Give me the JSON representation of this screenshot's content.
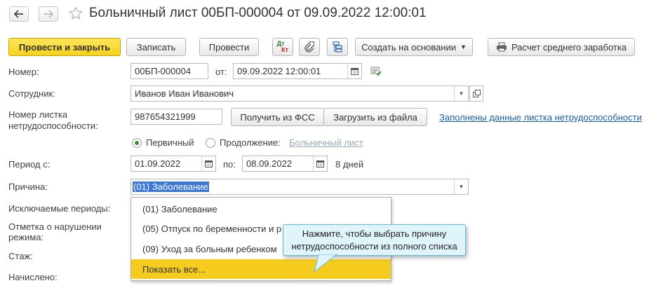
{
  "window": {
    "title": "Больничный лист 00БП-000004 от 09.09.2022 12:00:01"
  },
  "toolbar": {
    "post_close": "Провести и закрыть",
    "save": "Записать",
    "post": "Провести",
    "dtkt_top": "Дт",
    "dtkt_bottom": "Кт",
    "create_based": "Создать на основании",
    "calc_avg": "Расчет среднего заработка"
  },
  "form": {
    "number_label": "Номер:",
    "number_value": "00БП-000004",
    "from_label": "от:",
    "date_value": "09.09.2022 12:00:01",
    "employee_label": "Сотрудник:",
    "employee_value": "Иванов Иван Иванович",
    "sheet_number_label_1": "Номер листка",
    "sheet_number_label_2": "нетрудоспособности:",
    "sheet_number_value": "987654321999",
    "get_fss": "Получить из ФСС",
    "load_file": "Загрузить из файла",
    "filled_link": "Заполнены данные листка нетрудоспособности",
    "radio_primary": "Первичный",
    "radio_continuation": "Продолжение:",
    "continuation_link": "Больничный лист",
    "period_label": "Период с:",
    "period_from": "01.09.2022",
    "period_to_label": "по:",
    "period_to": "08.09.2022",
    "days": "8 дней",
    "reason_label": "Причина:",
    "reason_value": "(01) Заболевание",
    "excluded_label": "Исключаемые периоды:",
    "violation_label_1": "Отметка о нарушении",
    "violation_label_2": "режима:",
    "experience_label": "Стаж:",
    "accrued_label": "Начислено:"
  },
  "dropdown": {
    "items": [
      "(01) Заболевание",
      "(05) Отпуск по беременности и р",
      "(09) Уход за больным ребенком",
      "Показать все..."
    ]
  },
  "tooltip": {
    "line1": "Нажмите, чтобы выбрать причину",
    "line2": "нетрудоспособности из полного списка"
  },
  "colors": {
    "primary_button": "#f5d21c",
    "highlight": "#f5cc1e",
    "link": "#1a5ea8",
    "tooltip_bg": "#dff5fb"
  }
}
